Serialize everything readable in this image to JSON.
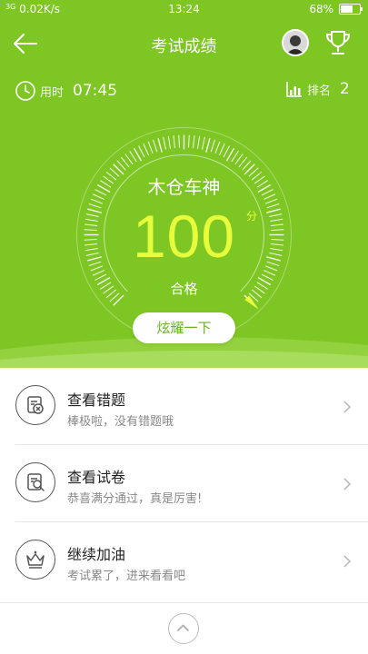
{
  "status_bar": {
    "network": "3G",
    "speed": "0.02K/s",
    "time": "13:24",
    "battery": "68%"
  },
  "nav": {
    "title": "考试成绩"
  },
  "stats": {
    "time_label": "用时",
    "time_value": "07:45",
    "rank_label": "排名",
    "rank_value": "2"
  },
  "result": {
    "name": "木仓车神",
    "score": "100",
    "score_unit": "分",
    "status": "合格",
    "gauge_fraction": 1.0
  },
  "share_button": {
    "label": "炫耀一下"
  },
  "menu": [
    {
      "title": "查看错题",
      "subtitle": "棒极啦，没有错题哦",
      "icon": "wrong-questions-icon"
    },
    {
      "title": "查看试卷",
      "subtitle": "恭喜满分通过，真是厉害!",
      "icon": "exam-paper-icon"
    },
    {
      "title": "继续加油",
      "subtitle": "考试累了，进来看看吧",
      "icon": "crown-icon"
    }
  ],
  "colors": {
    "brand_green": "#7dc623",
    "score_yellow": "#e7ff3a",
    "text_dark": "#222222",
    "text_gray": "#888888"
  }
}
